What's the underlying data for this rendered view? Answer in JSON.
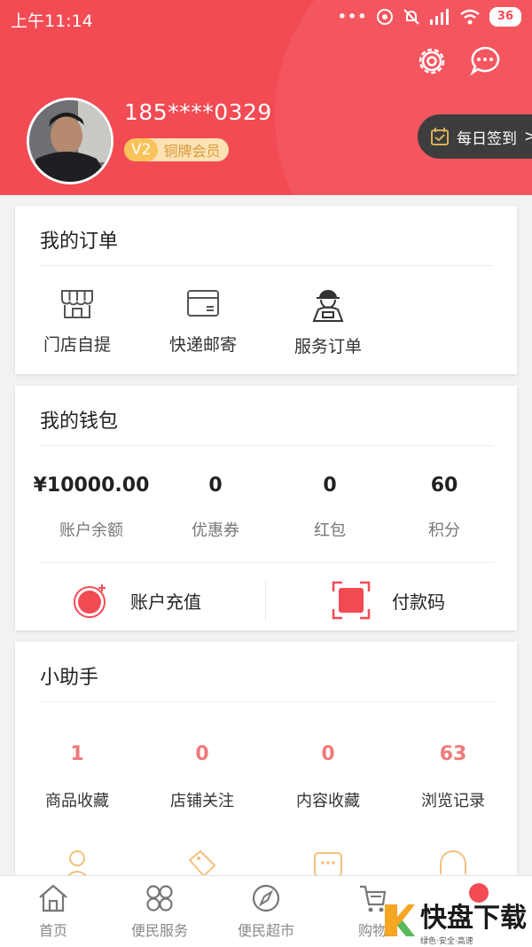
{
  "status_bar": {
    "time": "上午11:14",
    "battery": "36"
  },
  "header": {
    "phone": "185****0329",
    "level_badge": "V2",
    "level_name": "铜牌会员",
    "signin": "每日签到",
    "signin_arrow": ">"
  },
  "orders": {
    "title": "我的订单",
    "items": [
      {
        "label": "门店自提",
        "icon": "store-icon"
      },
      {
        "label": "快递邮寄",
        "icon": "parcel-icon"
      },
      {
        "label": "服务订单",
        "icon": "courier-icon"
      }
    ]
  },
  "wallet": {
    "title": "我的钱包",
    "stats": [
      {
        "value": "¥10000.00",
        "label": "账户余额"
      },
      {
        "value": "0",
        "label": "优惠券"
      },
      {
        "value": "0",
        "label": "红包"
      },
      {
        "value": "60",
        "label": "积分"
      }
    ],
    "recharge": "账户充值",
    "paycode": "付款码"
  },
  "helper": {
    "title": "小助手",
    "stats": [
      {
        "value": "1",
        "label": "商品收藏"
      },
      {
        "value": "0",
        "label": "店铺关注"
      },
      {
        "value": "0",
        "label": "内容收藏"
      },
      {
        "value": "63",
        "label": "浏览记录"
      }
    ]
  },
  "tabbar": {
    "items": [
      {
        "label": "首页",
        "icon": "home-icon"
      },
      {
        "label": "便民服务",
        "icon": "grid-icon"
      },
      {
        "label": "便民超市",
        "icon": "compass-icon"
      },
      {
        "label": "购物",
        "icon": "cart-icon"
      }
    ]
  },
  "watermark": {
    "brand": "快盘下载",
    "slogan": "绿色·安全·高速"
  },
  "colors": {
    "primary": "#f24b54",
    "accent_value": "#f07a7a",
    "badge": "#f7c35a"
  }
}
